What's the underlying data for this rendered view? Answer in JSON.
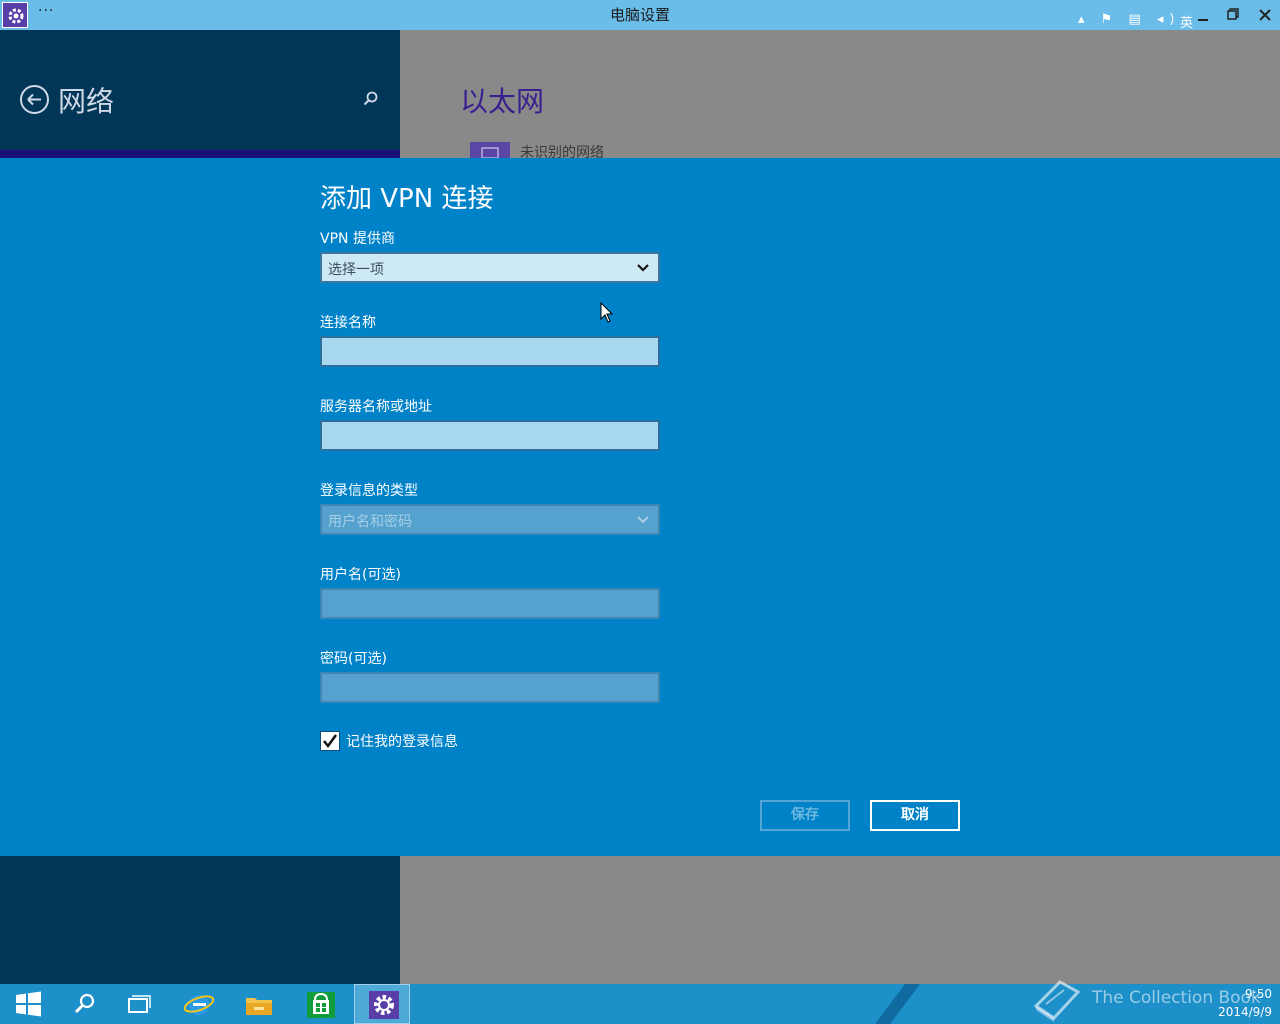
{
  "window": {
    "title": "电脑设置",
    "menu_dots": "···"
  },
  "settings": {
    "left_title": "网络",
    "right_title": "以太网",
    "network_label": "未识别的网络"
  },
  "dialog": {
    "title": "添加 VPN 连接",
    "provider_label": "VPN 提供商",
    "provider_value": "选择一项",
    "connection_name_label": "连接名称",
    "connection_name_value": "",
    "server_label": "服务器名称或地址",
    "server_value": "",
    "signin_type_label": "登录信息的类型",
    "signin_type_value": "用户名和密码",
    "username_label": "用户名(可选)",
    "username_value": "",
    "password_label": "密码(可选)",
    "password_value": "",
    "remember_label": "记住我的登录信息",
    "remember_checked": true,
    "save_label": "保存",
    "cancel_label": "取消"
  },
  "taskbar": {
    "items": [
      "start",
      "search",
      "task-view",
      "internet-explorer",
      "file-explorer",
      "store",
      "pc-settings"
    ],
    "tray_lang": "英",
    "time": "9:50",
    "date": "2014/9/9"
  },
  "watermark": {
    "text": "The Collection Book"
  },
  "colors": {
    "titlebar": "#6bbde9",
    "left_pane": "#013656",
    "right_pane": "#898989",
    "dialog": "#0082c9",
    "taskbar": "#1d8fc9"
  }
}
